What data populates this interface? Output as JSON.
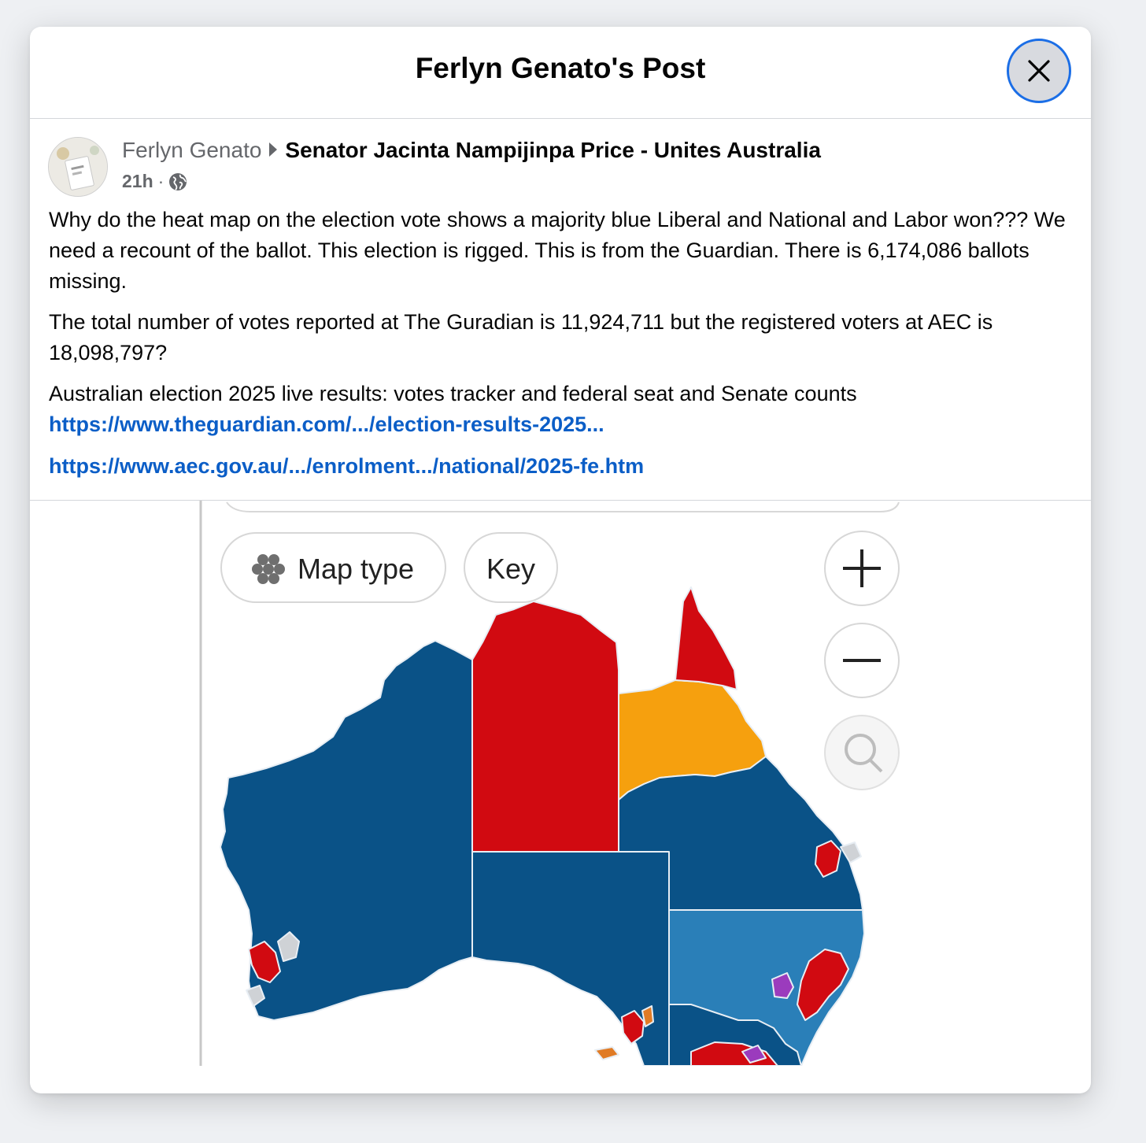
{
  "dialog": {
    "title": "Ferlyn Genato's Post",
    "close_icon": "close-icon"
  },
  "post": {
    "author": "Ferlyn Genato",
    "group": "Senator Jacinta Nampijinpa Price - Unites Australia",
    "time": "21h",
    "separator": "·",
    "privacy_icon": "globe-icon",
    "paragraphs": [
      "Why do the heat map on the election vote shows a majority blue Liberal and National and Labor won??? We need a recount of the ballot. This election is rigged. This is from the Guardian. There is 6,174,086 ballots missing.",
      "The total number of votes reported at The Guradian is 11,924,711 but the registered voters at AEC is 18,098,797?",
      "Australian election 2025 live results: votes tracker and federal seat and Senate counts"
    ],
    "links": [
      "https://www.theguardian.com/.../election-results-2025...",
      "https://www.aec.gov.au/.../enrolment.../national/2025-fe.htm"
    ]
  },
  "map_image": {
    "map_type_label": "Map type",
    "key_label": "Key",
    "zoom_in_icon": "plus-icon",
    "zoom_out_icon": "minus-icon",
    "reset_icon": "search-reset-icon",
    "colors": {
      "coalition_dark": "#0a5287",
      "coalition_light": "#2a7fb8",
      "labor": "#d10a11",
      "katter": "#f6a00e",
      "independent": "#9b3bbd",
      "grey": "#cfd2d6"
    }
  }
}
